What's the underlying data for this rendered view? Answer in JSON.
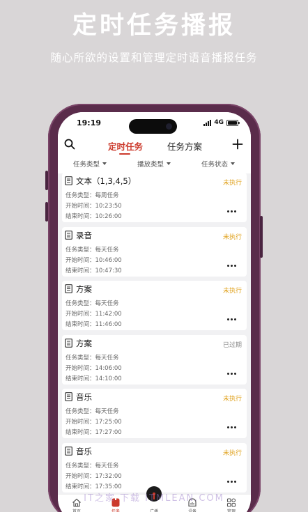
{
  "promo": {
    "title": "定时任务播报",
    "subtitle": "随心所欲的设置和管理定时语音播报任务"
  },
  "status_bar": {
    "time": "19:19",
    "network": "4G"
  },
  "header": {
    "tabs": [
      {
        "label": "定时任务",
        "active": true
      },
      {
        "label": "任务方案",
        "active": false
      }
    ],
    "search_icon": "search-icon",
    "add_icon": "plus-icon"
  },
  "filters": [
    {
      "label": "任务类型"
    },
    {
      "label": "播放类型"
    },
    {
      "label": "任务状态"
    }
  ],
  "tasks": [
    {
      "title": "文本（1,3,4,5）",
      "status": "未执行",
      "type_line": "任务类型：每周任务",
      "start_line": "开始时间：10:23:50",
      "end_line": "结束时间：10:26:00"
    },
    {
      "title": "录音",
      "status": "未执行",
      "type_line": "任务类型：每天任务",
      "start_line": "开始时间：10:46:00",
      "end_line": "结束时间：10:47:30"
    },
    {
      "title": "方案",
      "status": "未执行",
      "type_line": "任务类型：每天任务",
      "start_line": "开始时间：11:42:00",
      "end_line": "结束时间：11:46:00"
    },
    {
      "title": "方案",
      "status": "已过期",
      "type_line": "任务类型：每天任务",
      "start_line": "开始时间：14:06:00",
      "end_line": "结束时间：14:10:00"
    },
    {
      "title": "音乐",
      "status": "未执行",
      "type_line": "任务类型：每天任务",
      "start_line": "开始时间：17:25:00",
      "end_line": "结束时间：17:27:00"
    },
    {
      "title": "音乐",
      "status": "未执行",
      "type_line": "任务类型：每天任务",
      "start_line": "开始时间：17:32:00",
      "end_line": "结束时间：17:35:00"
    }
  ],
  "bottom_nav": [
    {
      "label": "首页",
      "icon": "home-icon"
    },
    {
      "label": "任务",
      "icon": "task-icon",
      "active": true
    },
    {
      "label": "广播",
      "icon": "broadcast-icon"
    },
    {
      "label": "设备",
      "icon": "device-icon"
    },
    {
      "label": "管理",
      "icon": "grid-icon"
    }
  ],
  "colors": {
    "accent": "#cc3a2c",
    "pending": "#e0a11b",
    "expired": "#888888",
    "phone_frame": "#5a2c4b",
    "background": "#d9d6d7"
  },
  "watermark": "IT之家 下载 ITMLEAN.COM"
}
